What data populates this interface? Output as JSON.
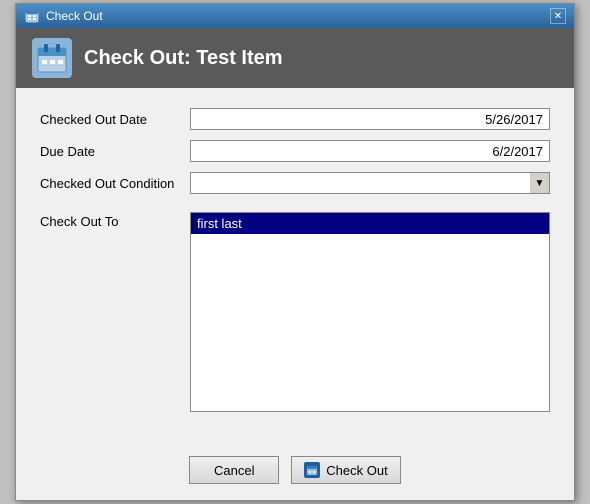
{
  "window": {
    "title": "Check Out",
    "close_label": "✕"
  },
  "header": {
    "title": "Check Out: Test Item",
    "icon": "📅"
  },
  "form": {
    "checked_out_date_label": "Checked Out Date",
    "checked_out_date_value": "5/26/2017",
    "due_date_label": "Due Date",
    "due_date_value": "6/2/2017",
    "checked_out_condition_label": "Checked Out Condition",
    "checked_out_condition_value": "",
    "check_out_to_label": "Check Out To",
    "check_out_to_item": "first last"
  },
  "buttons": {
    "cancel_label": "Cancel",
    "checkout_label": "Check Out",
    "checkout_icon": "📅"
  }
}
